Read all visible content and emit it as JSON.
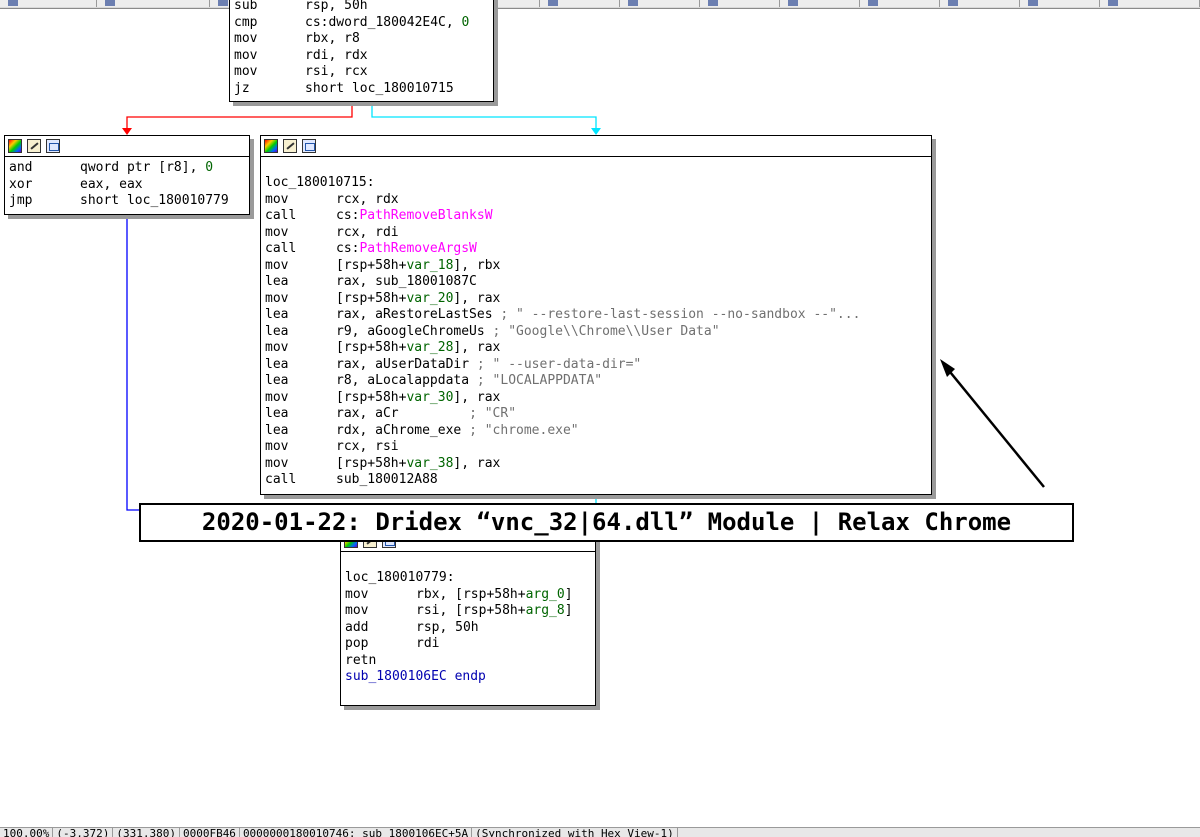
{
  "tabs": [
    "",
    "",
    "",
    "",
    "",
    "",
    "",
    "",
    "",
    "",
    "",
    "",
    "",
    ""
  ],
  "top_block": {
    "lines": [
      {
        "mn": "sub",
        "op": [
          {
            "t": "rsp, 50h",
            "c": ""
          }
        ]
      },
      {
        "mn": "cmp",
        "op": [
          {
            "t": "cs:dword_180042E4C, ",
            "c": ""
          },
          {
            "t": "0",
            "c": "grn"
          }
        ]
      },
      {
        "mn": "mov",
        "op": [
          {
            "t": "rbx, r8",
            "c": ""
          }
        ]
      },
      {
        "mn": "mov",
        "op": [
          {
            "t": "rdi, rdx",
            "c": ""
          }
        ]
      },
      {
        "mn": "mov",
        "op": [
          {
            "t": "rsi, rcx",
            "c": ""
          }
        ]
      },
      {
        "mn": "jz",
        "op": [
          {
            "t": "short loc_180010715",
            "c": ""
          }
        ]
      }
    ]
  },
  "left_block": {
    "lines": [
      {
        "mn": "and",
        "op": [
          {
            "t": "qword ptr [r8], ",
            "c": ""
          },
          {
            "t": "0",
            "c": "grn"
          }
        ]
      },
      {
        "mn": "xor",
        "op": [
          {
            "t": "eax, eax",
            "c": ""
          }
        ]
      },
      {
        "mn": "jmp",
        "op": [
          {
            "t": "short loc_180010779",
            "c": ""
          }
        ]
      }
    ]
  },
  "main_block": {
    "label": "loc_180010715:",
    "lines": [
      {
        "mn": "mov",
        "op": [
          {
            "t": "rcx, rdx",
            "c": ""
          }
        ]
      },
      {
        "mn": "call",
        "op": [
          {
            "t": "cs:",
            "c": ""
          },
          {
            "t": "PathRemoveBlanksW",
            "c": "pink"
          }
        ]
      },
      {
        "mn": "mov",
        "op": [
          {
            "t": "rcx, rdi",
            "c": ""
          }
        ]
      },
      {
        "mn": "call",
        "op": [
          {
            "t": "cs:",
            "c": ""
          },
          {
            "t": "PathRemoveArgsW",
            "c": "pink"
          }
        ]
      },
      {
        "mn": "mov",
        "op": [
          {
            "t": "[rsp+58h+",
            "c": ""
          },
          {
            "t": "var_18",
            "c": "grn"
          },
          {
            "t": "], rbx",
            "c": ""
          }
        ]
      },
      {
        "mn": "lea",
        "op": [
          {
            "t": "rax, sub_18001087C",
            "c": ""
          }
        ]
      },
      {
        "mn": "mov",
        "op": [
          {
            "t": "[rsp+58h+",
            "c": ""
          },
          {
            "t": "var_20",
            "c": "grn"
          },
          {
            "t": "], rax",
            "c": ""
          }
        ]
      },
      {
        "mn": "lea",
        "op": [
          {
            "t": "rax, aRestoreLastSes ",
            "c": ""
          },
          {
            "t": "; \" --restore-last-session --no-sandbox --\"...",
            "c": "gry"
          }
        ]
      },
      {
        "mn": "lea",
        "op": [
          {
            "t": "r9, aGoogleChromeUs ",
            "c": ""
          },
          {
            "t": "; \"Google\\\\Chrome\\\\User Data\"",
            "c": "gry"
          }
        ]
      },
      {
        "mn": "mov",
        "op": [
          {
            "t": "[rsp+58h+",
            "c": ""
          },
          {
            "t": "var_28",
            "c": "grn"
          },
          {
            "t": "], rax",
            "c": ""
          }
        ]
      },
      {
        "mn": "lea",
        "op": [
          {
            "t": "rax, aUserDataDir ",
            "c": ""
          },
          {
            "t": "; \" --user-data-dir=\"",
            "c": "gry"
          }
        ]
      },
      {
        "mn": "lea",
        "op": [
          {
            "t": "r8, aLocalappdata ",
            "c": ""
          },
          {
            "t": "; \"LOCALAPPDATA\"",
            "c": "gry"
          }
        ]
      },
      {
        "mn": "mov",
        "op": [
          {
            "t": "[rsp+58h+",
            "c": ""
          },
          {
            "t": "var_30",
            "c": "grn"
          },
          {
            "t": "], rax",
            "c": ""
          }
        ]
      },
      {
        "mn": "lea",
        "op": [
          {
            "t": "rax, aCr         ",
            "c": ""
          },
          {
            "t": "; \"CR\"",
            "c": "gry"
          }
        ]
      },
      {
        "mn": "lea",
        "op": [
          {
            "t": "rdx, aChrome_exe ",
            "c": ""
          },
          {
            "t": "; \"chrome.exe\"",
            "c": "gry"
          }
        ]
      },
      {
        "mn": "mov",
        "op": [
          {
            "t": "rcx, rsi",
            "c": ""
          }
        ]
      },
      {
        "mn": "mov",
        "op": [
          {
            "t": "[rsp+58h+",
            "c": ""
          },
          {
            "t": "var_38",
            "c": "grn"
          },
          {
            "t": "], rax",
            "c": ""
          }
        ]
      },
      {
        "mn": "call",
        "op": [
          {
            "t": "sub_180012A88",
            "c": ""
          }
        ]
      }
    ]
  },
  "bottom_block": {
    "label": "loc_180010779:",
    "lines": [
      {
        "mn": "mov",
        "op": [
          {
            "t": "rbx, [rsp+58h+",
            "c": ""
          },
          {
            "t": "arg_0",
            "c": "grn"
          },
          {
            "t": "]",
            "c": ""
          }
        ]
      },
      {
        "mn": "mov",
        "op": [
          {
            "t": "rsi, [rsp+58h+",
            "c": ""
          },
          {
            "t": "arg_8",
            "c": "grn"
          },
          {
            "t": "]",
            "c": ""
          }
        ]
      },
      {
        "mn": "add",
        "op": [
          {
            "t": "rsp, 50h",
            "c": ""
          }
        ]
      },
      {
        "mn": "pop",
        "op": [
          {
            "t": "rdi",
            "c": ""
          }
        ]
      },
      {
        "mn": "retn",
        "op": []
      }
    ],
    "endp": "sub_1800106EC endp"
  },
  "banner": "2020-01-22: Dridex “vnc_32|64.dll” Module | Relax Chrome",
  "status_bar": [
    "100.00%",
    "(-3,372)",
    "(331,380)",
    "0000FB46",
    "0000000180010746: sub_1800106EC+5A",
    "(Synchronized with Hex View-1)"
  ],
  "colors": {
    "edge_false": "#ff0000",
    "edge_true": "#00e5ff",
    "edge_jump": "#0000ff",
    "arrow": "#000000"
  }
}
